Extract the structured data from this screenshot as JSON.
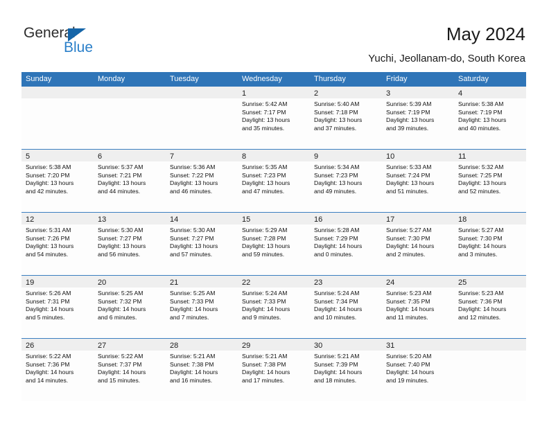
{
  "brand": {
    "name_part1": "General",
    "name_part2": "Blue",
    "triangle_color": "#1565a8",
    "blue_text_color": "#2a7fc9"
  },
  "header": {
    "title": "May 2024",
    "location": "Yuchi, Jeollanam-do, South Korea"
  },
  "theme": {
    "header_blue": "#2f75b8",
    "row_divider_blue": "#3a7ec0",
    "daynum_band_gray": "#efefef",
    "cell_background": "#fdfdfd"
  },
  "calendar": {
    "weekday_headers": [
      "Sunday",
      "Monday",
      "Tuesday",
      "Wednesday",
      "Thursday",
      "Friday",
      "Saturday"
    ],
    "weeks": [
      [
        {
          "day": "",
          "sunrise": "",
          "sunset": "",
          "daylight_line1": "",
          "daylight_line2": ""
        },
        {
          "day": "",
          "sunrise": "",
          "sunset": "",
          "daylight_line1": "",
          "daylight_line2": ""
        },
        {
          "day": "",
          "sunrise": "",
          "sunset": "",
          "daylight_line1": "",
          "daylight_line2": ""
        },
        {
          "day": "1",
          "sunrise": "Sunrise: 5:42 AM",
          "sunset": "Sunset: 7:17 PM",
          "daylight_line1": "Daylight: 13 hours",
          "daylight_line2": "and 35 minutes."
        },
        {
          "day": "2",
          "sunrise": "Sunrise: 5:40 AM",
          "sunset": "Sunset: 7:18 PM",
          "daylight_line1": "Daylight: 13 hours",
          "daylight_line2": "and 37 minutes."
        },
        {
          "day": "3",
          "sunrise": "Sunrise: 5:39 AM",
          "sunset": "Sunset: 7:19 PM",
          "daylight_line1": "Daylight: 13 hours",
          "daylight_line2": "and 39 minutes."
        },
        {
          "day": "4",
          "sunrise": "Sunrise: 5:38 AM",
          "sunset": "Sunset: 7:19 PM",
          "daylight_line1": "Daylight: 13 hours",
          "daylight_line2": "and 40 minutes."
        }
      ],
      [
        {
          "day": "5",
          "sunrise": "Sunrise: 5:38 AM",
          "sunset": "Sunset: 7:20 PM",
          "daylight_line1": "Daylight: 13 hours",
          "daylight_line2": "and 42 minutes."
        },
        {
          "day": "6",
          "sunrise": "Sunrise: 5:37 AM",
          "sunset": "Sunset: 7:21 PM",
          "daylight_line1": "Daylight: 13 hours",
          "daylight_line2": "and 44 minutes."
        },
        {
          "day": "7",
          "sunrise": "Sunrise: 5:36 AM",
          "sunset": "Sunset: 7:22 PM",
          "daylight_line1": "Daylight: 13 hours",
          "daylight_line2": "and 46 minutes."
        },
        {
          "day": "8",
          "sunrise": "Sunrise: 5:35 AM",
          "sunset": "Sunset: 7:23 PM",
          "daylight_line1": "Daylight: 13 hours",
          "daylight_line2": "and 47 minutes."
        },
        {
          "day": "9",
          "sunrise": "Sunrise: 5:34 AM",
          "sunset": "Sunset: 7:23 PM",
          "daylight_line1": "Daylight: 13 hours",
          "daylight_line2": "and 49 minutes."
        },
        {
          "day": "10",
          "sunrise": "Sunrise: 5:33 AM",
          "sunset": "Sunset: 7:24 PM",
          "daylight_line1": "Daylight: 13 hours",
          "daylight_line2": "and 51 minutes."
        },
        {
          "day": "11",
          "sunrise": "Sunrise: 5:32 AM",
          "sunset": "Sunset: 7:25 PM",
          "daylight_line1": "Daylight: 13 hours",
          "daylight_line2": "and 52 minutes."
        }
      ],
      [
        {
          "day": "12",
          "sunrise": "Sunrise: 5:31 AM",
          "sunset": "Sunset: 7:26 PM",
          "daylight_line1": "Daylight: 13 hours",
          "daylight_line2": "and 54 minutes."
        },
        {
          "day": "13",
          "sunrise": "Sunrise: 5:30 AM",
          "sunset": "Sunset: 7:27 PM",
          "daylight_line1": "Daylight: 13 hours",
          "daylight_line2": "and 56 minutes."
        },
        {
          "day": "14",
          "sunrise": "Sunrise: 5:30 AM",
          "sunset": "Sunset: 7:27 PM",
          "daylight_line1": "Daylight: 13 hours",
          "daylight_line2": "and 57 minutes."
        },
        {
          "day": "15",
          "sunrise": "Sunrise: 5:29 AM",
          "sunset": "Sunset: 7:28 PM",
          "daylight_line1": "Daylight: 13 hours",
          "daylight_line2": "and 59 minutes."
        },
        {
          "day": "16",
          "sunrise": "Sunrise: 5:28 AM",
          "sunset": "Sunset: 7:29 PM",
          "daylight_line1": "Daylight: 14 hours",
          "daylight_line2": "and 0 minutes."
        },
        {
          "day": "17",
          "sunrise": "Sunrise: 5:27 AM",
          "sunset": "Sunset: 7:30 PM",
          "daylight_line1": "Daylight: 14 hours",
          "daylight_line2": "and 2 minutes."
        },
        {
          "day": "18",
          "sunrise": "Sunrise: 5:27 AM",
          "sunset": "Sunset: 7:30 PM",
          "daylight_line1": "Daylight: 14 hours",
          "daylight_line2": "and 3 minutes."
        }
      ],
      [
        {
          "day": "19",
          "sunrise": "Sunrise: 5:26 AM",
          "sunset": "Sunset: 7:31 PM",
          "daylight_line1": "Daylight: 14 hours",
          "daylight_line2": "and 5 minutes."
        },
        {
          "day": "20",
          "sunrise": "Sunrise: 5:25 AM",
          "sunset": "Sunset: 7:32 PM",
          "daylight_line1": "Daylight: 14 hours",
          "daylight_line2": "and 6 minutes."
        },
        {
          "day": "21",
          "sunrise": "Sunrise: 5:25 AM",
          "sunset": "Sunset: 7:33 PM",
          "daylight_line1": "Daylight: 14 hours",
          "daylight_line2": "and 7 minutes."
        },
        {
          "day": "22",
          "sunrise": "Sunrise: 5:24 AM",
          "sunset": "Sunset: 7:33 PM",
          "daylight_line1": "Daylight: 14 hours",
          "daylight_line2": "and 9 minutes."
        },
        {
          "day": "23",
          "sunrise": "Sunrise: 5:24 AM",
          "sunset": "Sunset: 7:34 PM",
          "daylight_line1": "Daylight: 14 hours",
          "daylight_line2": "and 10 minutes."
        },
        {
          "day": "24",
          "sunrise": "Sunrise: 5:23 AM",
          "sunset": "Sunset: 7:35 PM",
          "daylight_line1": "Daylight: 14 hours",
          "daylight_line2": "and 11 minutes."
        },
        {
          "day": "25",
          "sunrise": "Sunrise: 5:23 AM",
          "sunset": "Sunset: 7:36 PM",
          "daylight_line1": "Daylight: 14 hours",
          "daylight_line2": "and 12 minutes."
        }
      ],
      [
        {
          "day": "26",
          "sunrise": "Sunrise: 5:22 AM",
          "sunset": "Sunset: 7:36 PM",
          "daylight_line1": "Daylight: 14 hours",
          "daylight_line2": "and 14 minutes."
        },
        {
          "day": "27",
          "sunrise": "Sunrise: 5:22 AM",
          "sunset": "Sunset: 7:37 PM",
          "daylight_line1": "Daylight: 14 hours",
          "daylight_line2": "and 15 minutes."
        },
        {
          "day": "28",
          "sunrise": "Sunrise: 5:21 AM",
          "sunset": "Sunset: 7:38 PM",
          "daylight_line1": "Daylight: 14 hours",
          "daylight_line2": "and 16 minutes."
        },
        {
          "day": "29",
          "sunrise": "Sunrise: 5:21 AM",
          "sunset": "Sunset: 7:38 PM",
          "daylight_line1": "Daylight: 14 hours",
          "daylight_line2": "and 17 minutes."
        },
        {
          "day": "30",
          "sunrise": "Sunrise: 5:21 AM",
          "sunset": "Sunset: 7:39 PM",
          "daylight_line1": "Daylight: 14 hours",
          "daylight_line2": "and 18 minutes."
        },
        {
          "day": "31",
          "sunrise": "Sunrise: 5:20 AM",
          "sunset": "Sunset: 7:40 PM",
          "daylight_line1": "Daylight: 14 hours",
          "daylight_line2": "and 19 minutes."
        },
        {
          "day": "",
          "sunrise": "",
          "sunset": "",
          "daylight_line1": "",
          "daylight_line2": ""
        }
      ]
    ]
  }
}
